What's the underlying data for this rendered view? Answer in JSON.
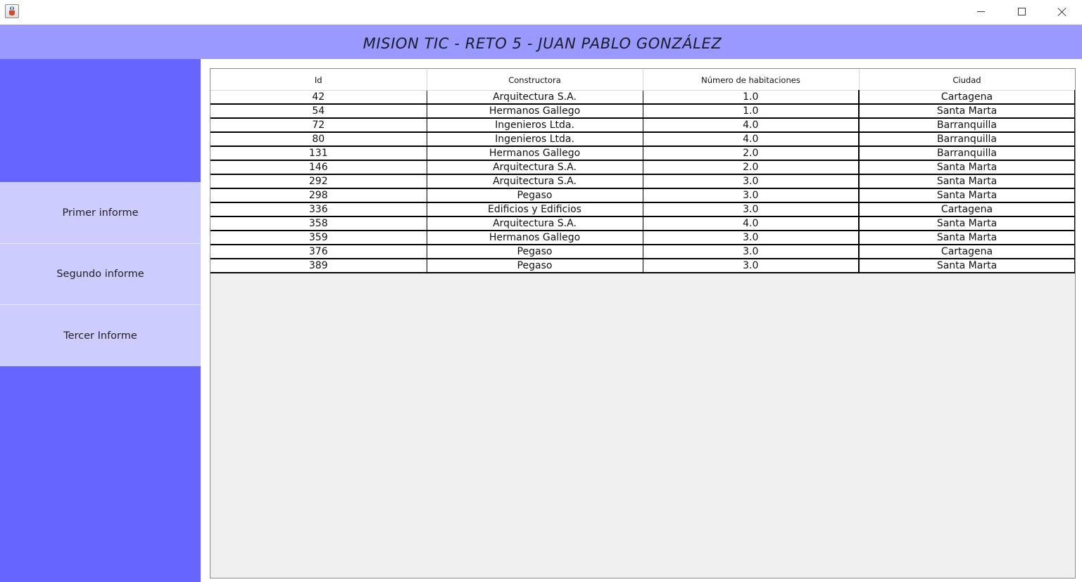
{
  "window": {
    "app_icon": "java-cup-icon",
    "controls": [
      "minimize-icon",
      "maximize-icon",
      "close-icon"
    ]
  },
  "header": {
    "title": "MISION TIC - RETO 5 - JUAN PABLO GONZÁLEZ",
    "background": "#9999ff"
  },
  "sidebar": {
    "background": "#6666ff",
    "button_background": "#ccccff",
    "buttons": [
      "Primer informe",
      "Segundo informe",
      "Tercer Informe"
    ]
  },
  "table": {
    "columns": [
      "Id",
      "Constructora",
      "Número de habitaciones",
      "Ciudad"
    ],
    "rows": [
      [
        "42",
        "Arquitectura S.A.",
        "1.0",
        "Cartagena"
      ],
      [
        "54",
        "Hermanos Gallego",
        "1.0",
        "Santa Marta"
      ],
      [
        "72",
        "Ingenieros Ltda.",
        "4.0",
        "Barranquilla"
      ],
      [
        "80",
        "Ingenieros Ltda.",
        "4.0",
        "Barranquilla"
      ],
      [
        "131",
        "Hermanos Gallego",
        "2.0",
        "Barranquilla"
      ],
      [
        "146",
        "Arquitectura S.A.",
        "2.0",
        "Santa Marta"
      ],
      [
        "292",
        "Arquitectura S.A.",
        "3.0",
        "Santa Marta"
      ],
      [
        "298",
        "Pegaso",
        "3.0",
        "Santa Marta"
      ],
      [
        "336",
        "Edificios y Edificios",
        "3.0",
        "Cartagena"
      ],
      [
        "358",
        "Arquitectura S.A.",
        "4.0",
        "Santa Marta"
      ],
      [
        "359",
        "Hermanos Gallego",
        "3.0",
        "Santa Marta"
      ],
      [
        "376",
        "Pegaso",
        "3.0",
        "Cartagena"
      ],
      [
        "389",
        "Pegaso",
        "3.0",
        "Santa Marta"
      ]
    ]
  }
}
